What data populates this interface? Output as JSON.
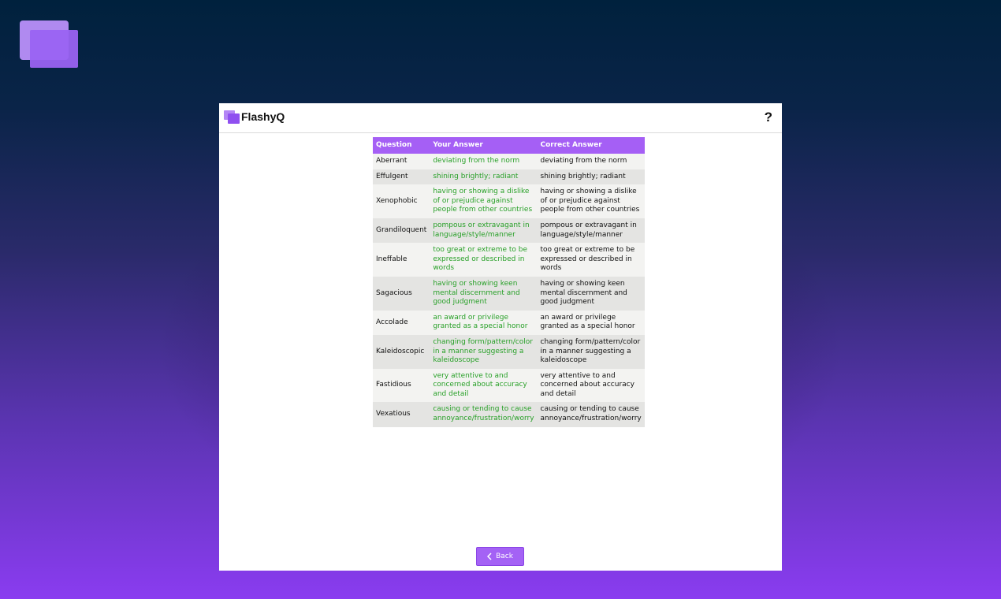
{
  "app": {
    "title": "FlashyQ",
    "help_label": "?"
  },
  "table": {
    "headers": [
      "Question",
      "Your Answer",
      "Correct Answer"
    ],
    "rows": [
      {
        "question": "Aberrant",
        "your_answer": "deviating from the norm",
        "correct_answer": "deviating from the norm"
      },
      {
        "question": "Effulgent",
        "your_answer": "shining brightly; radiant",
        "correct_answer": "shining brightly; radiant"
      },
      {
        "question": "Xenophobic",
        "your_answer": "having or showing a dislike of or prejudice against people from other countries",
        "correct_answer": "having or showing a dislike of or prejudice against people from other countries"
      },
      {
        "question": "Grandiloquent",
        "your_answer": "pompous or extravagant in language/style/manner",
        "correct_answer": "pompous or extravagant in language/style/manner"
      },
      {
        "question": "Ineffable",
        "your_answer": "too great or extreme to be expressed or described in words",
        "correct_answer": "too great or extreme to be expressed or described in words"
      },
      {
        "question": "Sagacious",
        "your_answer": "having or showing keen mental discernment and good judgment",
        "correct_answer": "having or showing keen mental discernment and good judgment"
      },
      {
        "question": "Accolade",
        "your_answer": "an award or privilege granted as a special honor",
        "correct_answer": "an award or privilege granted as a special honor"
      },
      {
        "question": "Kaleidoscopic",
        "your_answer": "changing form/pattern/color in a manner suggesting a kaleidoscope",
        "correct_answer": "changing form/pattern/color in a manner suggesting a kaleidoscope"
      },
      {
        "question": "Fastidious",
        "your_answer": "very attentive to and concerned about accuracy and detail",
        "correct_answer": "very attentive to and concerned about accuracy and detail"
      },
      {
        "question": "Vexatious",
        "your_answer": "causing or tending to cause annoyance/frustration/worry",
        "correct_answer": "causing or tending to cause annoyance/frustration/worry"
      }
    ]
  },
  "back_button": {
    "label": "Back",
    "icon": "chevron-left-icon"
  },
  "colors": {
    "accent": "#a55ff5",
    "your_answer_text": "#28a028",
    "row_light": "#f3f3f1",
    "row_dark": "#e4e4e2"
  }
}
